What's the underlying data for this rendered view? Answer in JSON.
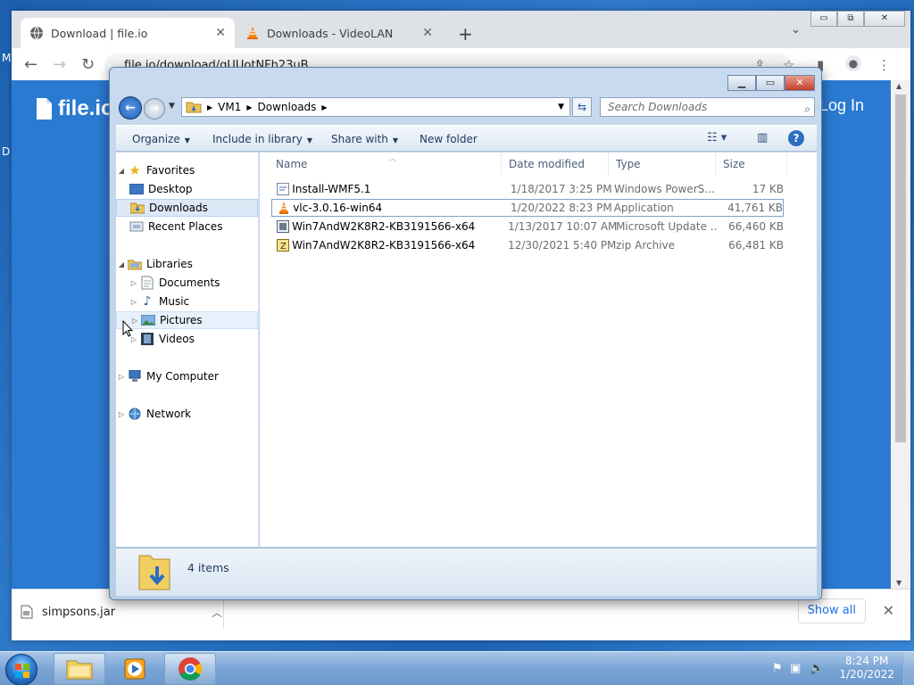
{
  "desktop": {
    "edge_letters": [
      "M",
      "D"
    ]
  },
  "browser": {
    "tabs": [
      {
        "title": "Download | file.io",
        "close": "✕",
        "active": true
      },
      {
        "title": "Downloads - VideoLAN",
        "close": "✕",
        "active": false
      }
    ],
    "new_tab": "+",
    "tab_search": "⌄",
    "window_controls": {
      "minimize": "▭",
      "restore": "⧉",
      "close": "✕"
    },
    "url": "file.io/download/qUUotNFh23uB",
    "page": {
      "logo_text": "file.io",
      "login_text": "Log In"
    },
    "download_bar": {
      "file_name": "simpsons.jar",
      "show_all_label": "Show all",
      "close": "✕"
    }
  },
  "explorer": {
    "breadcrumb": [
      "VM1",
      "Downloads"
    ],
    "search_placeholder": "Search Downloads",
    "command_bar": {
      "organize": "Organize",
      "include_in_library": "Include in library",
      "share_with": "Share with",
      "new_folder": "New folder"
    },
    "nav": {
      "favorites": "Favorites",
      "favorites_items": [
        "Desktop",
        "Downloads",
        "Recent Places"
      ],
      "libraries": "Libraries",
      "libraries_items": [
        "Documents",
        "Music",
        "Pictures",
        "Videos"
      ],
      "my_computer": "My Computer",
      "network": "Network"
    },
    "columns": [
      "Name",
      "Date modified",
      "Type",
      "Size"
    ],
    "files": [
      {
        "name": "Install-WMF5.1",
        "date": "1/18/2017 3:25 PM",
        "type": "Windows PowerS...",
        "size": "17 KB",
        "icon": "script-icon"
      },
      {
        "name": "vlc-3.0.16-win64",
        "date": "1/20/2022 8:23 PM",
        "type": "Application",
        "size": "41,761 KB",
        "icon": "vlc-cone-icon"
      },
      {
        "name": "Win7AndW2K8R2-KB3191566-x64",
        "date": "1/13/2017 10:07 AM",
        "type": "Microsoft Update ...",
        "size": "66,460 KB",
        "icon": "update-package-icon"
      },
      {
        "name": "Win7AndW2K8R2-KB3191566-x64",
        "date": "12/30/2021 5:40 PM",
        "type": "zip Archive",
        "size": "66,481 KB",
        "icon": "zip-icon"
      }
    ],
    "status": "4 items"
  },
  "taskbar": {
    "time": "8:24 PM",
    "date": "1/20/2022"
  }
}
